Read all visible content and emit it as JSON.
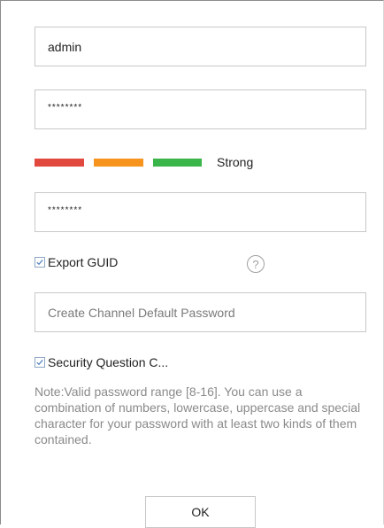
{
  "form": {
    "username_value": "admin",
    "password_value": "********",
    "confirm_value": "********",
    "strength_label": "Strong",
    "strength_level": "3 of 3",
    "export_guid_label": "Export GUID",
    "export_guid_checked": true,
    "help_glyph": "?",
    "channel_password_placeholder": "Create Channel Default Password",
    "security_question_label": "Security Question C...",
    "security_question_checked": true,
    "note": "Note:Valid password range [8-16]. You can use a combination of numbers, lowercase, uppercase and special character for your password with at least two kinds of them contained.",
    "ok_label": "OK"
  },
  "colors": {
    "strength_red": "#e2493e",
    "strength_orange": "#f7941d",
    "strength_green": "#3ab54a"
  },
  "icons": [
    "checkbox-checked-icon",
    "help-icon"
  ]
}
